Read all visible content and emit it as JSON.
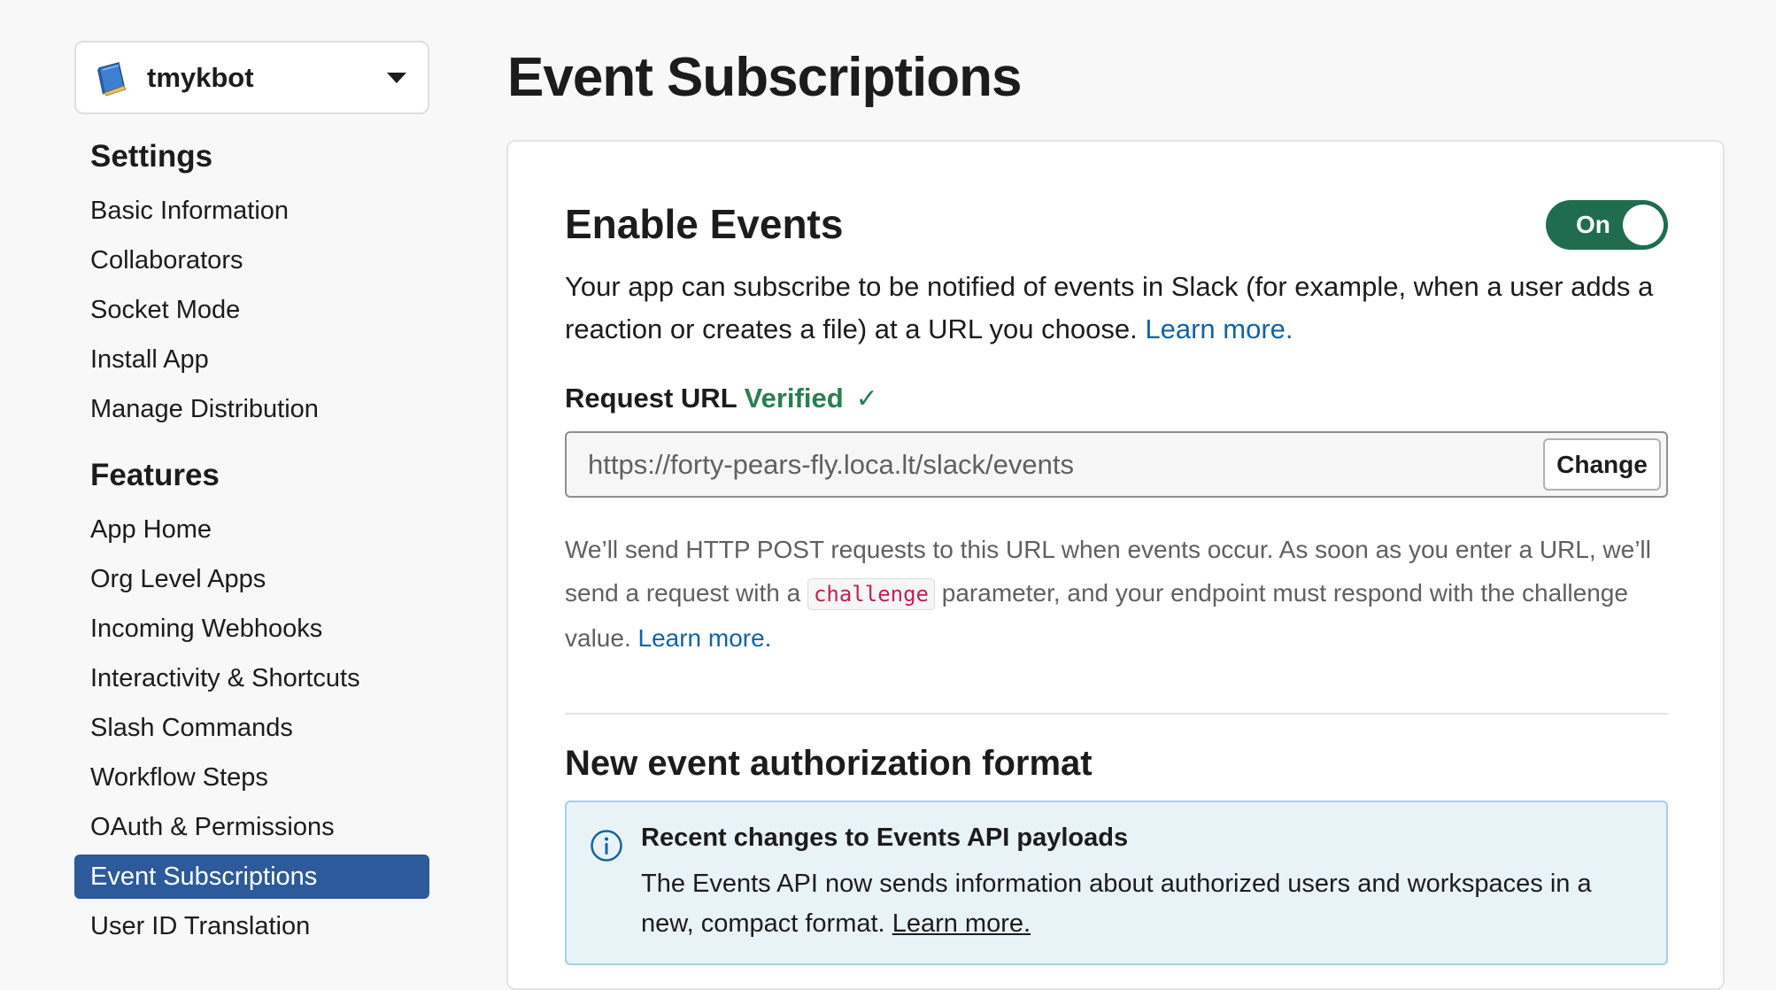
{
  "app": {
    "name": "tmykbot"
  },
  "sidebar": {
    "settings_heading": "Settings",
    "settings_items": [
      {
        "label": "Basic Information"
      },
      {
        "label": "Collaborators"
      },
      {
        "label": "Socket Mode"
      },
      {
        "label": "Install App"
      },
      {
        "label": "Manage Distribution"
      }
    ],
    "features_heading": "Features",
    "features_items": [
      {
        "label": "App Home"
      },
      {
        "label": "Org Level Apps"
      },
      {
        "label": "Incoming Webhooks"
      },
      {
        "label": "Interactivity & Shortcuts"
      },
      {
        "label": "Slash Commands"
      },
      {
        "label": "Workflow Steps"
      },
      {
        "label": "OAuth & Permissions"
      },
      {
        "label": "Event Subscriptions",
        "active": true
      },
      {
        "label": "User ID Translation"
      }
    ]
  },
  "main": {
    "title": "Event Subscriptions",
    "enable_events": {
      "title": "Enable Events",
      "toggle_label": "On",
      "toggle_state": "on",
      "description": "Your app can subscribe to be notified of events in Slack (for example, when a user adds a reaction or creates a file) at a URL you choose.",
      "learn_more": "Learn more."
    },
    "request_url": {
      "label": "Request URL",
      "status": "Verified",
      "check_glyph": "✓",
      "value": "https://forty-pears-fly.loca.lt/slack/events",
      "change_button": "Change",
      "help_before": "We’ll send HTTP POST requests to this URL when events occur. As soon as you enter a URL, we’ll send a request with a",
      "help_code": "challenge",
      "help_after": "parameter, and your endpoint must respond with the challenge value.",
      "help_learn_more": "Learn more."
    },
    "authorization": {
      "title": "New event authorization format",
      "info_title": "Recent changes to Events API payloads",
      "info_text": "The Events API now sends information about authorized users and workspaces in a new, compact format.",
      "info_learn_more": "Learn more."
    }
  },
  "colors": {
    "active_nav": "#2d5a9b",
    "toggle_on": "#1f6d4e",
    "verified": "#2a7d4f",
    "link": "#1264a3",
    "info_bg": "#e8f3f8",
    "info_border": "#a6cfe5",
    "code_text": "#c0234e"
  },
  "icons": {
    "app_icon": "book-icon",
    "caret": "caret-down-icon",
    "info": "info-circle-icon",
    "check": "check-icon"
  }
}
